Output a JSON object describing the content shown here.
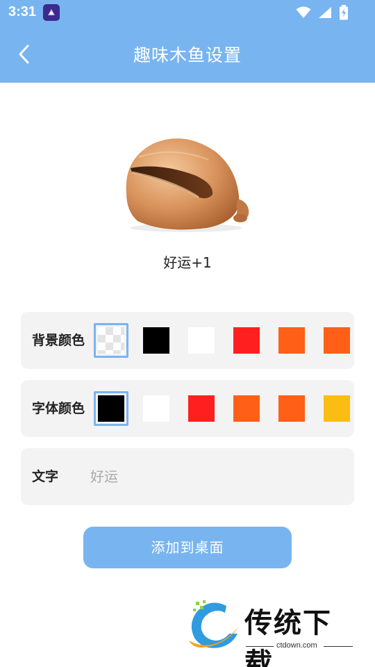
{
  "status_bar": {
    "time": "3:31"
  },
  "header": {
    "title": "趣味木鱼设置"
  },
  "preview": {
    "text": "好运+1"
  },
  "background_color": {
    "label": "背景颜色",
    "swatches": [
      {
        "color": "transparent",
        "selected": true
      },
      {
        "color": "#000000",
        "selected": false
      },
      {
        "color": "#ffffff",
        "selected": false
      },
      {
        "color": "#ff1f1f",
        "selected": false
      },
      {
        "color": "#ff5f17",
        "selected": false
      },
      {
        "color": "#ff5f17",
        "selected": false
      }
    ]
  },
  "font_color": {
    "label": "字体颜色",
    "swatches": [
      {
        "color": "#000000",
        "selected": true
      },
      {
        "color": "#ffffff",
        "selected": false
      },
      {
        "color": "#ff1f1f",
        "selected": false
      },
      {
        "color": "#ff5f17",
        "selected": false
      },
      {
        "color": "#ff5f17",
        "selected": false
      },
      {
        "color": "#fbbd14",
        "selected": false
      }
    ]
  },
  "text_field": {
    "label": "文字",
    "placeholder": "好运",
    "value": ""
  },
  "actions": {
    "add_to_desktop": "添加到桌面"
  },
  "watermark": {
    "title": "传统下载",
    "url": "ctdown.com"
  },
  "colors": {
    "accent": "#78b4f0",
    "card_bg": "#f3f3f3"
  }
}
